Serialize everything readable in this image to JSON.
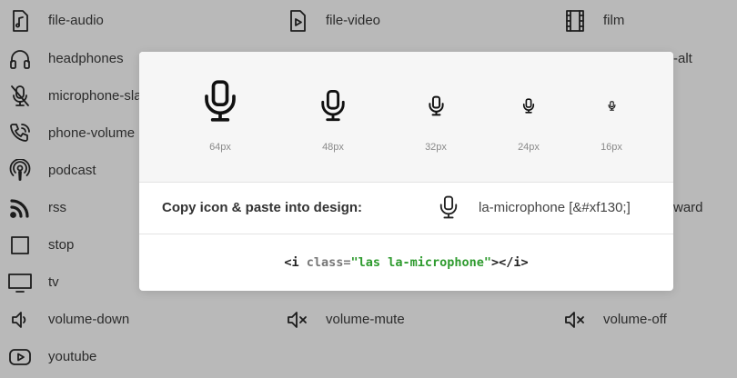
{
  "background_icons": [
    {
      "label": "file-audio",
      "icon": "file-audio-icon"
    },
    {
      "label": "file-video",
      "icon": "file-video-icon"
    },
    {
      "label": "film",
      "icon": "film-icon"
    },
    {
      "label": "headphones",
      "icon": "headphones-icon"
    },
    {
      "label": "microphone-slash",
      "icon": "microphone-slash-icon"
    },
    {
      "label": "phone-volume",
      "icon": "phone-volume-icon"
    },
    {
      "label": "podcast",
      "icon": "podcast-icon"
    },
    {
      "label": "rss",
      "icon": "rss-icon"
    },
    {
      "label": "stop",
      "icon": "stop-icon"
    },
    {
      "label": "tv",
      "icon": "tv-icon"
    },
    {
      "label": "volume-down",
      "icon": "volume-down-icon"
    },
    {
      "label": "volume-mute",
      "icon": "volume-mute-icon"
    },
    {
      "label": "volume-off",
      "icon": "volume-off-icon"
    },
    {
      "label": "youtube",
      "icon": "youtube-icon"
    }
  ],
  "partial_labels": [
    "-alt",
    "ward"
  ],
  "modal": {
    "icon": "microphone-icon",
    "sizes": [
      "64px",
      "48px",
      "32px",
      "24px",
      "16px"
    ],
    "copy_label": "Copy icon & paste into design:",
    "icon_name": "la-microphone",
    "icon_code": "[&#xf130;]",
    "code": {
      "open": "<i ",
      "attr": "class=",
      "value": "\"las la-microphone\"",
      "close": "></i>"
    }
  },
  "colors": {
    "overlay": "#b9b9b9",
    "modal_bg": "#ffffff",
    "sizes_bg": "#f6f6f6",
    "code_string": "#2f9b2f"
  }
}
